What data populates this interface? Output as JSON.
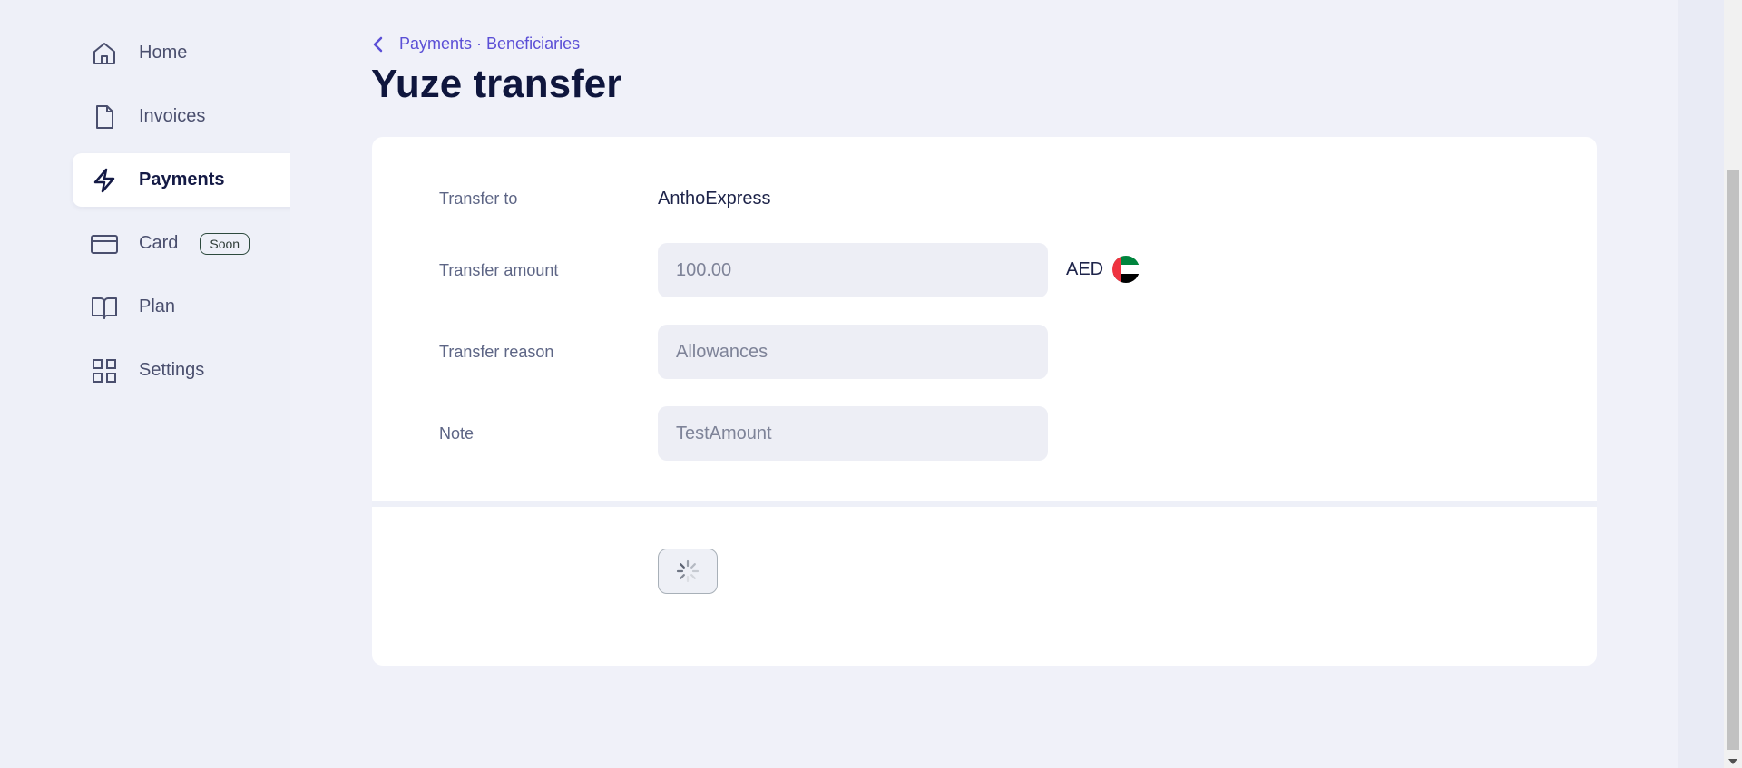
{
  "sidebar": {
    "items": [
      {
        "label": "Home",
        "icon": "home-icon",
        "active": false
      },
      {
        "label": "Invoices",
        "icon": "document-icon",
        "active": false
      },
      {
        "label": "Payments",
        "icon": "lightning-icon",
        "active": true
      },
      {
        "label": "Card",
        "icon": "credit-card-icon",
        "active": false,
        "badge": "Soon"
      },
      {
        "label": "Plan",
        "icon": "book-icon",
        "active": false
      },
      {
        "label": "Settings",
        "icon": "grid-icon",
        "active": false
      }
    ]
  },
  "breadcrumb": {
    "text": "Payments · Beneficiaries",
    "icon": "chevron-left-icon"
  },
  "page": {
    "title": "Yuze transfer"
  },
  "form": {
    "transfer_to": {
      "label": "Transfer to",
      "value": "AnthoExpress"
    },
    "transfer_amount": {
      "label": "Transfer amount",
      "value": "100.00",
      "currency": "AED",
      "flag_icon": "uae-flag-icon"
    },
    "transfer_reason": {
      "label": "Transfer reason",
      "value": "Allowances"
    },
    "note": {
      "label": "Note",
      "value": "TestAmount"
    }
  },
  "submit": {
    "state": "loading",
    "icon": "spinner-icon"
  },
  "colors": {
    "accent": "#5b4fd6",
    "title": "#0f163d",
    "background": "#f0f1f9",
    "card": "#ffffff",
    "field_bg": "#edeef5"
  }
}
